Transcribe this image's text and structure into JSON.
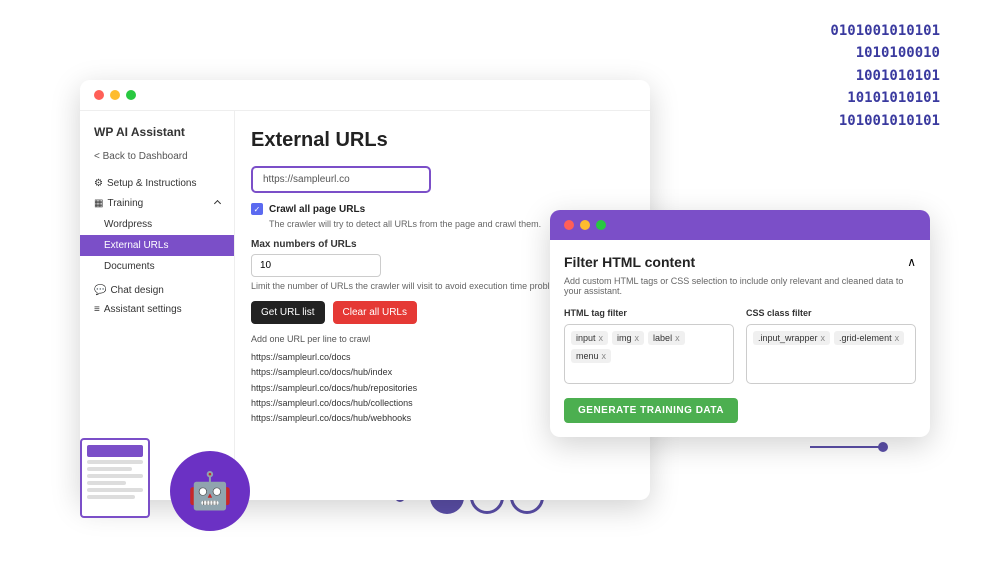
{
  "binary": {
    "lines": [
      "0101001010101",
      "1010100010",
      "1001010101",
      "10101010101",
      "101001010101"
    ]
  },
  "mainWindow": {
    "title": "External URLs",
    "sidebar": {
      "brand": "WP AI Assistant",
      "backLabel": "< Back to Dashboard",
      "setupLabel": "Setup & Instructions",
      "trainingLabel": "Training",
      "items": [
        "Wordpress",
        "External URLs",
        "Documents"
      ],
      "chatDesign": "Chat design",
      "assistantSettings": "Assistant settings"
    },
    "content": {
      "urlInput": "https://sampleurl.co",
      "crawlCheckboxLabel": "Crawl all page URLs",
      "crawlDesc": "The crawler will try to detect all URLs from the page and crawl them.",
      "maxUrlsLabel": "Max numbers of URLs",
      "maxUrlsValue": "10",
      "maxUrlsHint": "Limit the number of URLs the crawler will visit to avoid execution time problems",
      "btnGetList": "Get URL list",
      "btnClearAll": "Clear all URLs",
      "urlsNote": "Add one URL per line to crawl",
      "urlList": [
        "https://sampleurl.co/docs",
        "https://sampleurl.co/docs/hub/index",
        "https://sampleurl.co/docs/hub/repositories",
        "https://sampleurl.co/docs/hub/collections",
        "https://sampleurl.co/docs/hub/webhooks"
      ]
    }
  },
  "filterWindow": {
    "title": "Filter HTML content",
    "toggleLabel": "^",
    "desc": "Add custom HTML tags or CSS selection to include only relevant and cleaned data to your assistant.",
    "htmlTagFilterLabel": "HTML tag filter",
    "cssClassFilterLabel": "CSS class filter",
    "htmlTags": [
      "input",
      "img",
      "label",
      "menu"
    ],
    "cssTags": [
      ".input_wrapper",
      ".grid-element"
    ],
    "btnGenerate": "GENERATE TRAINING DATA"
  }
}
